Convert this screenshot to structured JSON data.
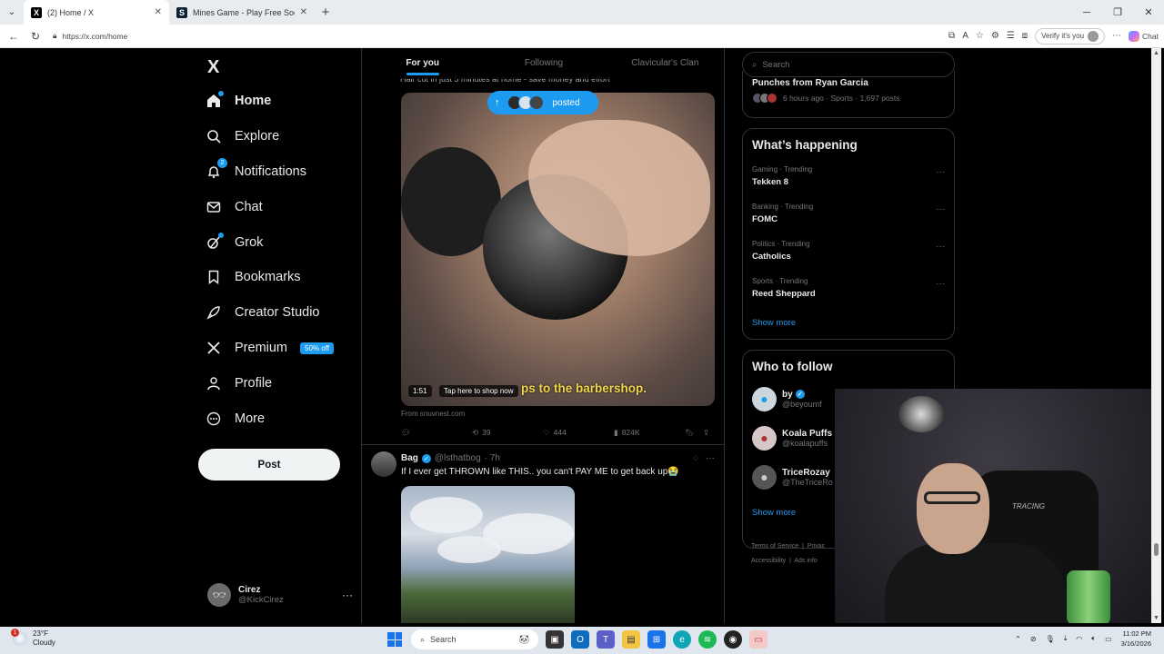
{
  "browser": {
    "tabs": [
      {
        "title": "(2) Home / X",
        "active": true,
        "favicon": "X"
      },
      {
        "title": "Mines Game - Play Free Social Cas",
        "active": false,
        "favicon": "S"
      }
    ],
    "url": "https://x.com/home",
    "verify_label": "Verify it's you",
    "chat_label": "Chat"
  },
  "nav": {
    "logo": "X",
    "items": [
      {
        "label": "Home",
        "icon": "home-icon"
      },
      {
        "label": "Explore",
        "icon": "search-icon"
      },
      {
        "label": "Notifications",
        "icon": "bell-icon",
        "badge": "2"
      },
      {
        "label": "Chat",
        "icon": "mail-icon"
      },
      {
        "label": "Grok",
        "icon": "grok-icon"
      },
      {
        "label": "Bookmarks",
        "icon": "bookmark-icon"
      },
      {
        "label": "Creator Studio",
        "icon": "rocket-icon"
      },
      {
        "label": "Premium",
        "icon": "x-icon",
        "badge": "50% off"
      },
      {
        "label": "Profile",
        "icon": "person-icon"
      },
      {
        "label": "More",
        "icon": "more-circle-icon"
      }
    ],
    "post_label": "Post",
    "account": {
      "name": "Cirez",
      "handle": "@KickCirez"
    }
  },
  "timeline": {
    "tabs": [
      "For you",
      "Following",
      "Clavicular's Clan"
    ],
    "cut_text": "Hair cut in just 5 minutes at home - save money and effort",
    "posted_pill": "posted",
    "post1": {
      "duration": "1:51",
      "shop_label": "Tap here to shop now",
      "caption": "ps to the barbershop.",
      "from": "From snuvnest.com",
      "retweets": "39",
      "likes": "444",
      "views": "824K"
    },
    "post2": {
      "name": "Bag",
      "handle": "@lsthatbog",
      "time": "· 7h",
      "text": "If I ever get THROWN like THIS.. you can't PAY ME to get back up😭"
    }
  },
  "right": {
    "search_placeholder": "Search",
    "top_story": {
      "title": "Punches from Ryan Garcia",
      "meta": "6 hours ago · Sports · 1,697 posts"
    },
    "happening_title": "What’s happening",
    "trends": [
      {
        "category": "Gaming · Trending",
        "name": "Tekken 8"
      },
      {
        "category": "Banking · Trending",
        "name": "FOMC"
      },
      {
        "category": "Politics · Trending",
        "name": "Catholics"
      },
      {
        "category": "Sports · Trending",
        "name": "Reed Sheppard"
      }
    ],
    "show_more": "Show more",
    "follow_title": "Who to follow",
    "follow": [
      {
        "name": "by",
        "handle": "@beyoumf"
      },
      {
        "name": "Koala Puffs",
        "handle": "@koalapuffs"
      },
      {
        "name": "TriceRozay",
        "handle": "@TheTriceRo"
      }
    ],
    "footer": [
      "Terms of Service",
      "|",
      "Privac",
      "Accessibility",
      "|",
      "Ads info"
    ]
  },
  "taskbar": {
    "temp": "23°F",
    "condition": "Cloudy",
    "weather_badge": "1",
    "search_label": "Search",
    "time": "11:02 PM",
    "date": "3/16/2026"
  },
  "webcam": {
    "chair_text": "TRACING"
  }
}
